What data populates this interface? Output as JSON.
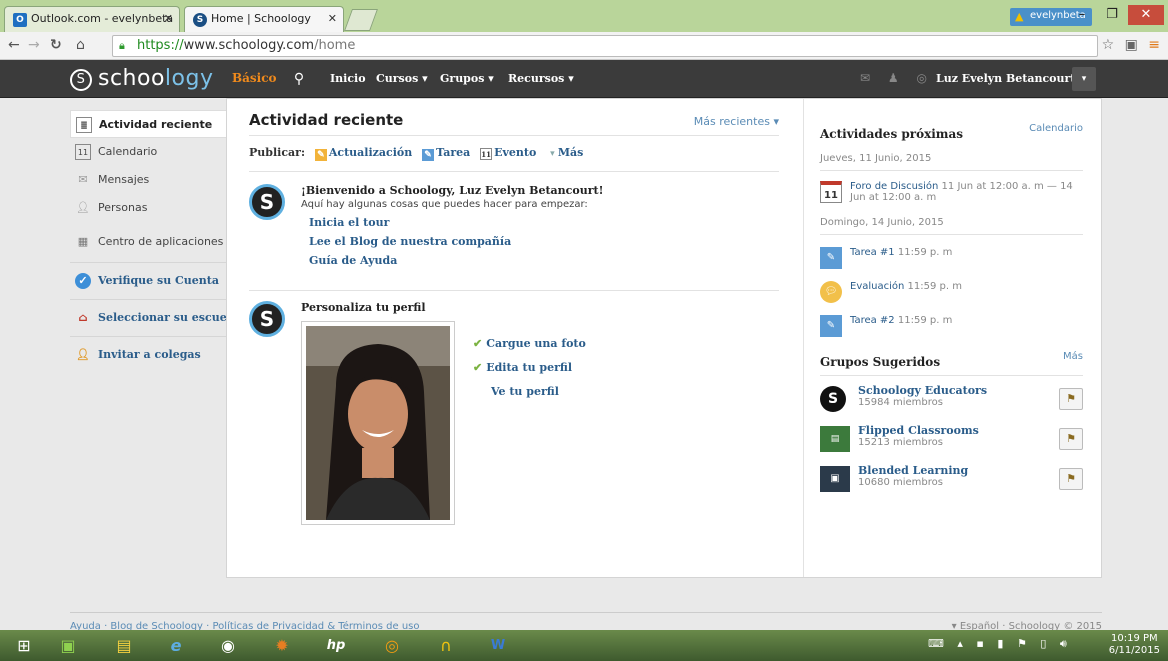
{
  "browser": {
    "tabs": [
      {
        "label": "Outlook.com - evelynbeta"
      },
      {
        "label": "Home | Schoology"
      }
    ],
    "url_protocol": "https://",
    "url_host": "www.schoology.com",
    "url_path": "/home",
    "profile_badge": "evelynbeta"
  },
  "header": {
    "logo_text_a": "schoo",
    "logo_text_b": "logy",
    "mode": "Básico",
    "nav": [
      "Inicio",
      "Cursos",
      "Grupos",
      "Recursos"
    ],
    "user_name": "Luz Evelyn Betancourt"
  },
  "sidebar": {
    "items": [
      {
        "label": "Actividad reciente",
        "icon": "activity-icon"
      },
      {
        "label": "Calendario",
        "icon": "calendar-icon"
      },
      {
        "label": "Mensajes",
        "icon": "envelope-icon"
      },
      {
        "label": "Personas",
        "icon": "person-icon"
      },
      {
        "label": "Centro de aplicaciones",
        "icon": "apps-icon"
      },
      {
        "label": "Verifique su Cuenta",
        "icon": "shield-check-icon"
      },
      {
        "label": "Seleccionar su escuela",
        "icon": "school-icon"
      },
      {
        "label": "Invitar a colegas",
        "icon": "add-person-icon"
      }
    ]
  },
  "feed": {
    "title": "Actividad reciente",
    "sort": "Más recientes",
    "publish_label": "Publicar:",
    "publish_options": [
      "Actualización",
      "Tarea",
      "Evento",
      "Más"
    ],
    "welcome_title": "¡Bienvenido a Schoology, Luz Evelyn Betancourt!",
    "welcome_text": "Aquí hay algunas cosas que puedes hacer para empezar:",
    "welcome_links": [
      "Inicia el tour",
      "Lee el Blog de nuestra compañía",
      "Guía de Ayuda"
    ],
    "profile_title": "Personaliza tu perfil",
    "profile_actions": [
      "Cargue una foto",
      "Edita tu perfil",
      "Ve tu perfil"
    ]
  },
  "upcoming": {
    "title": "Actividades próximas",
    "calendar_link": "Calendario",
    "days": [
      {
        "date": "Jueves, 11 Junio, 2015",
        "events": [
          {
            "name": "Foro de Discusión",
            "time": "11 Jun at 12:00 a. m — 14 Jun at 12:00 a. m",
            "icon": "calendar-11-icon"
          }
        ]
      },
      {
        "date": "Domingo, 14 Junio, 2015",
        "events": [
          {
            "name": "Tarea #1",
            "time": "11:59 p. m",
            "icon": "assignment-icon"
          },
          {
            "name": "Evaluación",
            "time": "11:59 p. m",
            "icon": "speech-bubble-icon"
          },
          {
            "name": "Tarea #2",
            "time": "11:59 p. m",
            "icon": "assignment-icon"
          }
        ]
      }
    ]
  },
  "groups": {
    "title": "Grupos Sugeridos",
    "more_link": "Más",
    "items": [
      {
        "name": "Schoology Educators",
        "members": "15984 miembros"
      },
      {
        "name": "Flipped Classrooms",
        "members": "15213 miembros"
      },
      {
        "name": "Blended Learning",
        "members": "10680 miembros"
      }
    ]
  },
  "footer": {
    "left": "Ayuda · Blog de Schoology · Políticas de Privacidad & Términos de uso",
    "right": "▾ Español · Schoology © 2015"
  },
  "taskbar": {
    "time": "10:19 PM",
    "date": "6/11/2015"
  }
}
